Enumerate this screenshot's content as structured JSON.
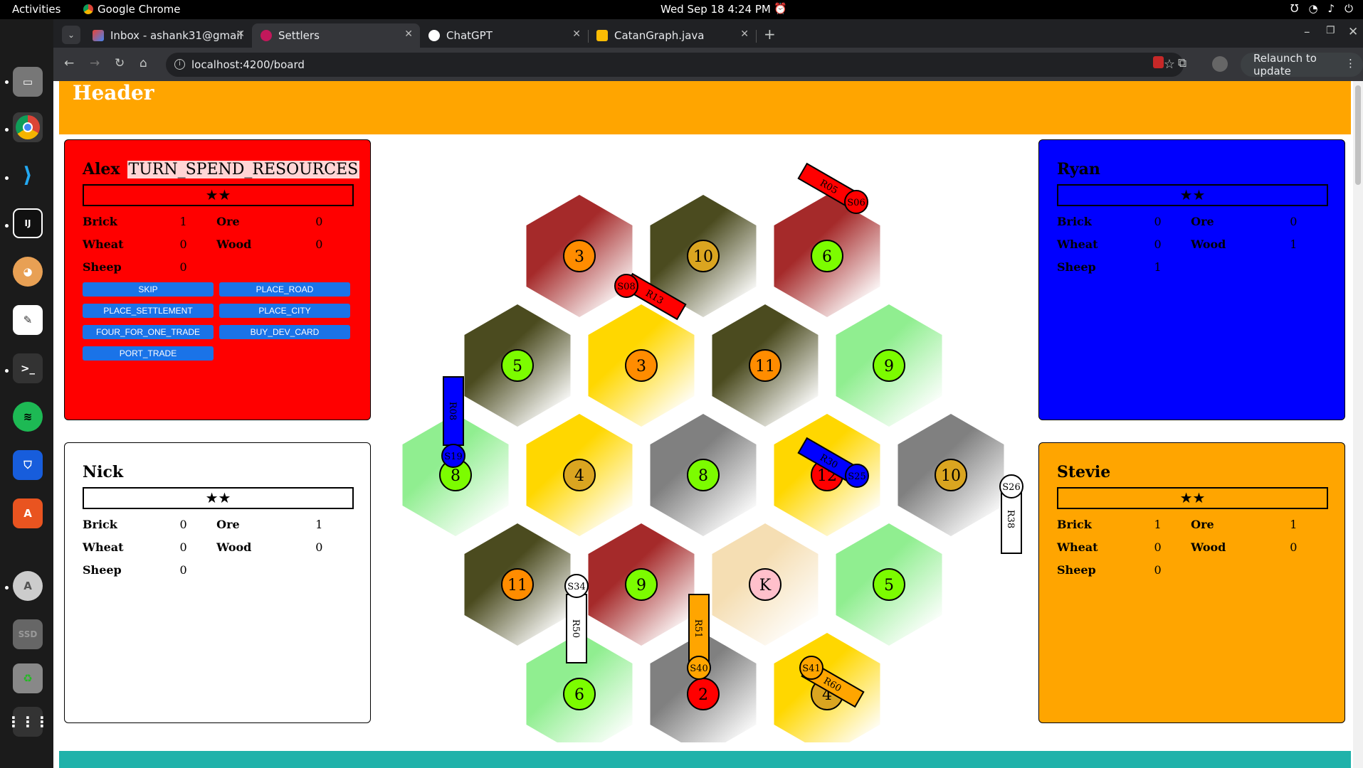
{
  "os": {
    "activities": "Activities",
    "app_name": "Google Chrome",
    "clock": "Wed Sep 18  4:24 PM"
  },
  "dock": {
    "items": [
      "files-icon",
      "chrome-icon",
      "vscode-icon",
      "intellij-icon",
      "dog-app-icon",
      "inkscape-icon",
      "terminal-icon",
      "spotify-icon",
      "bitwarden-icon",
      "app-center-icon",
      "software-updater-icon",
      "ssd-drive-icon",
      "trash-icon",
      "show-apps-icon"
    ]
  },
  "browser": {
    "tabs": [
      {
        "label": "Inbox - ashank31@gmail",
        "icon": "gmail-icon"
      },
      {
        "label": "Settlers",
        "icon": "settlers-icon"
      },
      {
        "label": "ChatGPT",
        "icon": "chatgpt-icon"
      },
      {
        "label": "CatanGraph.java",
        "icon": "java-file-icon"
      }
    ],
    "url": "localhost:4200/board",
    "relaunch": "Relaunch to update"
  },
  "page": {
    "header": "Header"
  },
  "players": {
    "alex": {
      "name": "Alex",
      "state": "TURN_SPEND_RESOURCES",
      "vp": "★★",
      "bg": "#ff0000",
      "brick_label": "Brick",
      "brick": "1",
      "ore_label": "Ore",
      "ore": "0",
      "wheat_label": "Wheat",
      "wheat": "0",
      "wood_label": "Wood",
      "wood": "0",
      "sheep_label": "Sheep",
      "sheep": "0",
      "actions": [
        "SKIP",
        "PLACE_ROAD",
        "PLACE_SETTLEMENT",
        "PLACE_CITY",
        "FOUR_FOR_ONE_TRADE",
        "BUY_DEV_CARD",
        "PORT_TRADE"
      ]
    },
    "ryan": {
      "name": "Ryan",
      "vp": "★★",
      "bg": "#0000ff",
      "brick_label": "Brick",
      "brick": "0",
      "ore_label": "Ore",
      "ore": "0",
      "wheat_label": "Wheat",
      "wheat": "0",
      "wood_label": "Wood",
      "wood": "1",
      "sheep_label": "Sheep",
      "sheep": "1"
    },
    "nick": {
      "name": "Nick",
      "vp": "★★",
      "bg": "#ffffff",
      "brick_label": "Brick",
      "brick": "0",
      "ore_label": "Ore",
      "ore": "1",
      "wheat_label": "Wheat",
      "wheat": "0",
      "wood_label": "Wood",
      "wood": "0",
      "sheep_label": "Sheep",
      "sheep": "0"
    },
    "stevie": {
      "name": "Stevie",
      "vp": "★★",
      "bg": "#ffa500",
      "brick_label": "Brick",
      "brick": "1",
      "ore_label": "Ore",
      "ore": "1",
      "wheat_label": "Wheat",
      "wheat": "0",
      "wood_label": "Wood",
      "wood": "0",
      "sheep_label": "Sheep",
      "sheep": "0"
    }
  },
  "resource_colors": {
    "brick": "#a52a2a",
    "forest": "#4b4b1f",
    "wheat": "#ffd700",
    "sheep": "#90ee90",
    "ore": "#808080",
    "desert": "#f5deb3"
  },
  "board": {
    "rows": [
      [
        {
          "res": "brick",
          "num": "3"
        },
        {
          "res": "forest",
          "num": "10"
        },
        {
          "res": "brick",
          "num": "6"
        }
      ],
      [
        {
          "res": "forest",
          "num": "5"
        },
        {
          "res": "wheat",
          "num": "3"
        },
        {
          "res": "forest",
          "num": "11"
        },
        {
          "res": "sheep",
          "num": "9"
        }
      ],
      [
        {
          "res": "sheep",
          "num": "8"
        },
        {
          "res": "wheat",
          "num": "4"
        },
        {
          "res": "ore",
          "num": "8"
        },
        {
          "res": "wheat",
          "num": "12"
        },
        {
          "res": "ore",
          "num": "10"
        }
      ],
      [
        {
          "res": "forest",
          "num": "11"
        },
        {
          "res": "brick",
          "num": "9"
        },
        {
          "res": "desert",
          "num": "K"
        },
        {
          "res": "sheep",
          "num": "5"
        }
      ],
      [
        {
          "res": "sheep",
          "num": "6"
        },
        {
          "res": "ore",
          "num": "2"
        },
        {
          "res": "wheat",
          "num": "4"
        }
      ]
    ],
    "roads": [
      {
        "id": "R05",
        "color": "#ff0000"
      },
      {
        "id": "R13",
        "color": "#ff0000"
      },
      {
        "id": "R08",
        "color": "#0000ff"
      },
      {
        "id": "R30",
        "color": "#0000ff"
      },
      {
        "id": "R38",
        "color": "#ffffff"
      },
      {
        "id": "R50",
        "color": "#ffffff"
      },
      {
        "id": "R51",
        "color": "#ffa500"
      },
      {
        "id": "R60",
        "color": "#ffa500"
      }
    ],
    "settlements": [
      {
        "id": "S06",
        "color": "#ff0000"
      },
      {
        "id": "S08",
        "color": "#ff0000"
      },
      {
        "id": "S19",
        "color": "#0000ff"
      },
      {
        "id": "S25",
        "color": "#0000ff"
      },
      {
        "id": "S26",
        "color": "#ffffff"
      },
      {
        "id": "S34",
        "color": "#ffffff"
      },
      {
        "id": "S40",
        "color": "#ffa500"
      },
      {
        "id": "S41",
        "color": "#ffa500"
      }
    ]
  }
}
